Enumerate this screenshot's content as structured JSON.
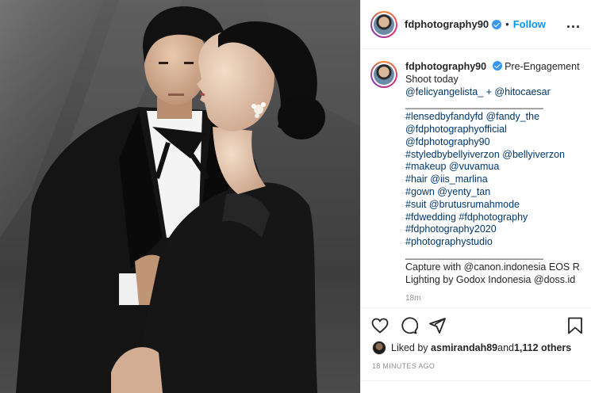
{
  "post": {
    "username": "fdphotography90",
    "follow_label": "Follow",
    "separator": "•",
    "more_label": "...",
    "photo_alt": "Pre-engagement couple portrait"
  },
  "caption": {
    "username": "fdphotography90",
    "lines": [
      "Pre-Engagement",
      "Shoot today",
      "@felicyangelista_ + @hitocaesar",
      "_________________________",
      "#lensedbyfandyfd @fandy_the",
      "@fdphotographyofficial",
      "@fdphotography90",
      "#styledbybellyiverzon @bellyiverzon",
      "#makeup @vuvamua",
      "#hair @iis_marlina",
      "#gown @yenty_tan",
      "#suit @brutusrumahmode",
      "#fdwedding #fdphotography",
      "#fdphotography2020",
      "#photographystudio",
      "_________________________",
      "Capture with @canon.indonesia EOS R",
      "Lighting by Godox Indonesia @doss.id"
    ],
    "time_peek": "18m"
  },
  "likes": {
    "prefix": "Liked by ",
    "user": "asmirandah89",
    "middle": " and ",
    "count": "1,112 others"
  },
  "timestamp": "18 MINUTES AGO",
  "icons": [
    "heart-icon",
    "comment-icon",
    "share-icon",
    "bookmark-icon",
    "verified-icon",
    "more-icon"
  ]
}
